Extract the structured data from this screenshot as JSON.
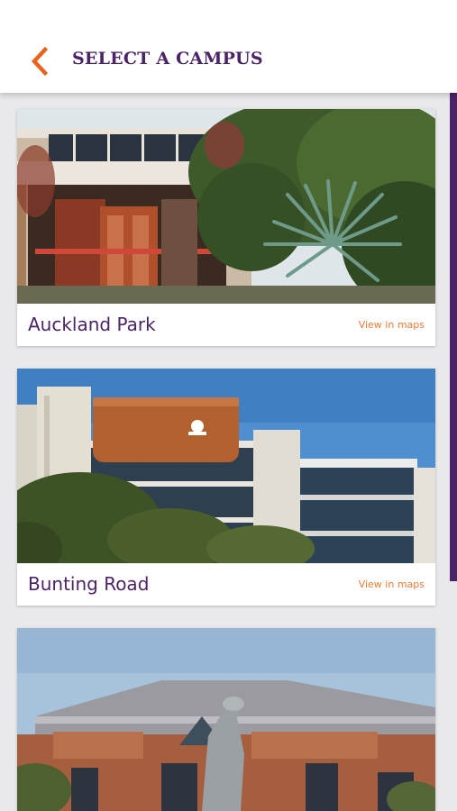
{
  "header": {
    "title": "SELECT A CAMPUS",
    "back_icon": "chevron-left-icon",
    "accent_color": "#e8641e",
    "title_color": "#4a2466"
  },
  "campuses": [
    {
      "name": "Auckland Park",
      "maps_label": "View in maps"
    },
    {
      "name": "Bunting Road",
      "maps_label": "View in maps"
    },
    {
      "name": "",
      "maps_label": ""
    }
  ],
  "scrollbar_color": "#4a2466"
}
